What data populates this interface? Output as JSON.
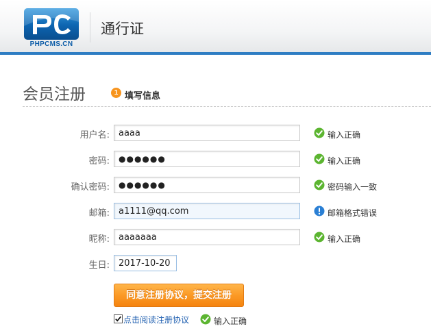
{
  "header": {
    "logo_text": "PHPCMS.CN",
    "title": "通行证"
  },
  "section": {
    "title": "会员注册",
    "step_number": "1",
    "step_label": "填写信息"
  },
  "form": {
    "username": {
      "label": "用户名:",
      "value": "aaaa",
      "status": "输入正确",
      "status_icon": "check-icon"
    },
    "password": {
      "label": "密码:",
      "value": "●●●●●●",
      "status": "输入正确",
      "status_icon": "check-icon"
    },
    "confirm_password": {
      "label": "确认密码:",
      "value": "●●●●●●",
      "status": "密码输入一致",
      "status_icon": "check-icon"
    },
    "email": {
      "label": "邮箱:",
      "value": "a1111@qq.com",
      "status": "邮箱格式错误",
      "status_icon": "info-icon"
    },
    "nickname": {
      "label": "昵称:",
      "value": "aaaaaaa",
      "status": "输入正确",
      "status_icon": "check-icon"
    },
    "birthday": {
      "label": "生日:",
      "value": "2017-10-20"
    }
  },
  "submit_label": "同意注册协议，提交注册",
  "agreement": {
    "checked": true,
    "link_text": "点击阅读注册协议",
    "status": "输入正确"
  },
  "colors": {
    "accent": "#2e7dc3",
    "success": "#5cb531",
    "info": "#2a7fd4",
    "button": "#f7941d",
    "step_badge": "#f7941d"
  }
}
